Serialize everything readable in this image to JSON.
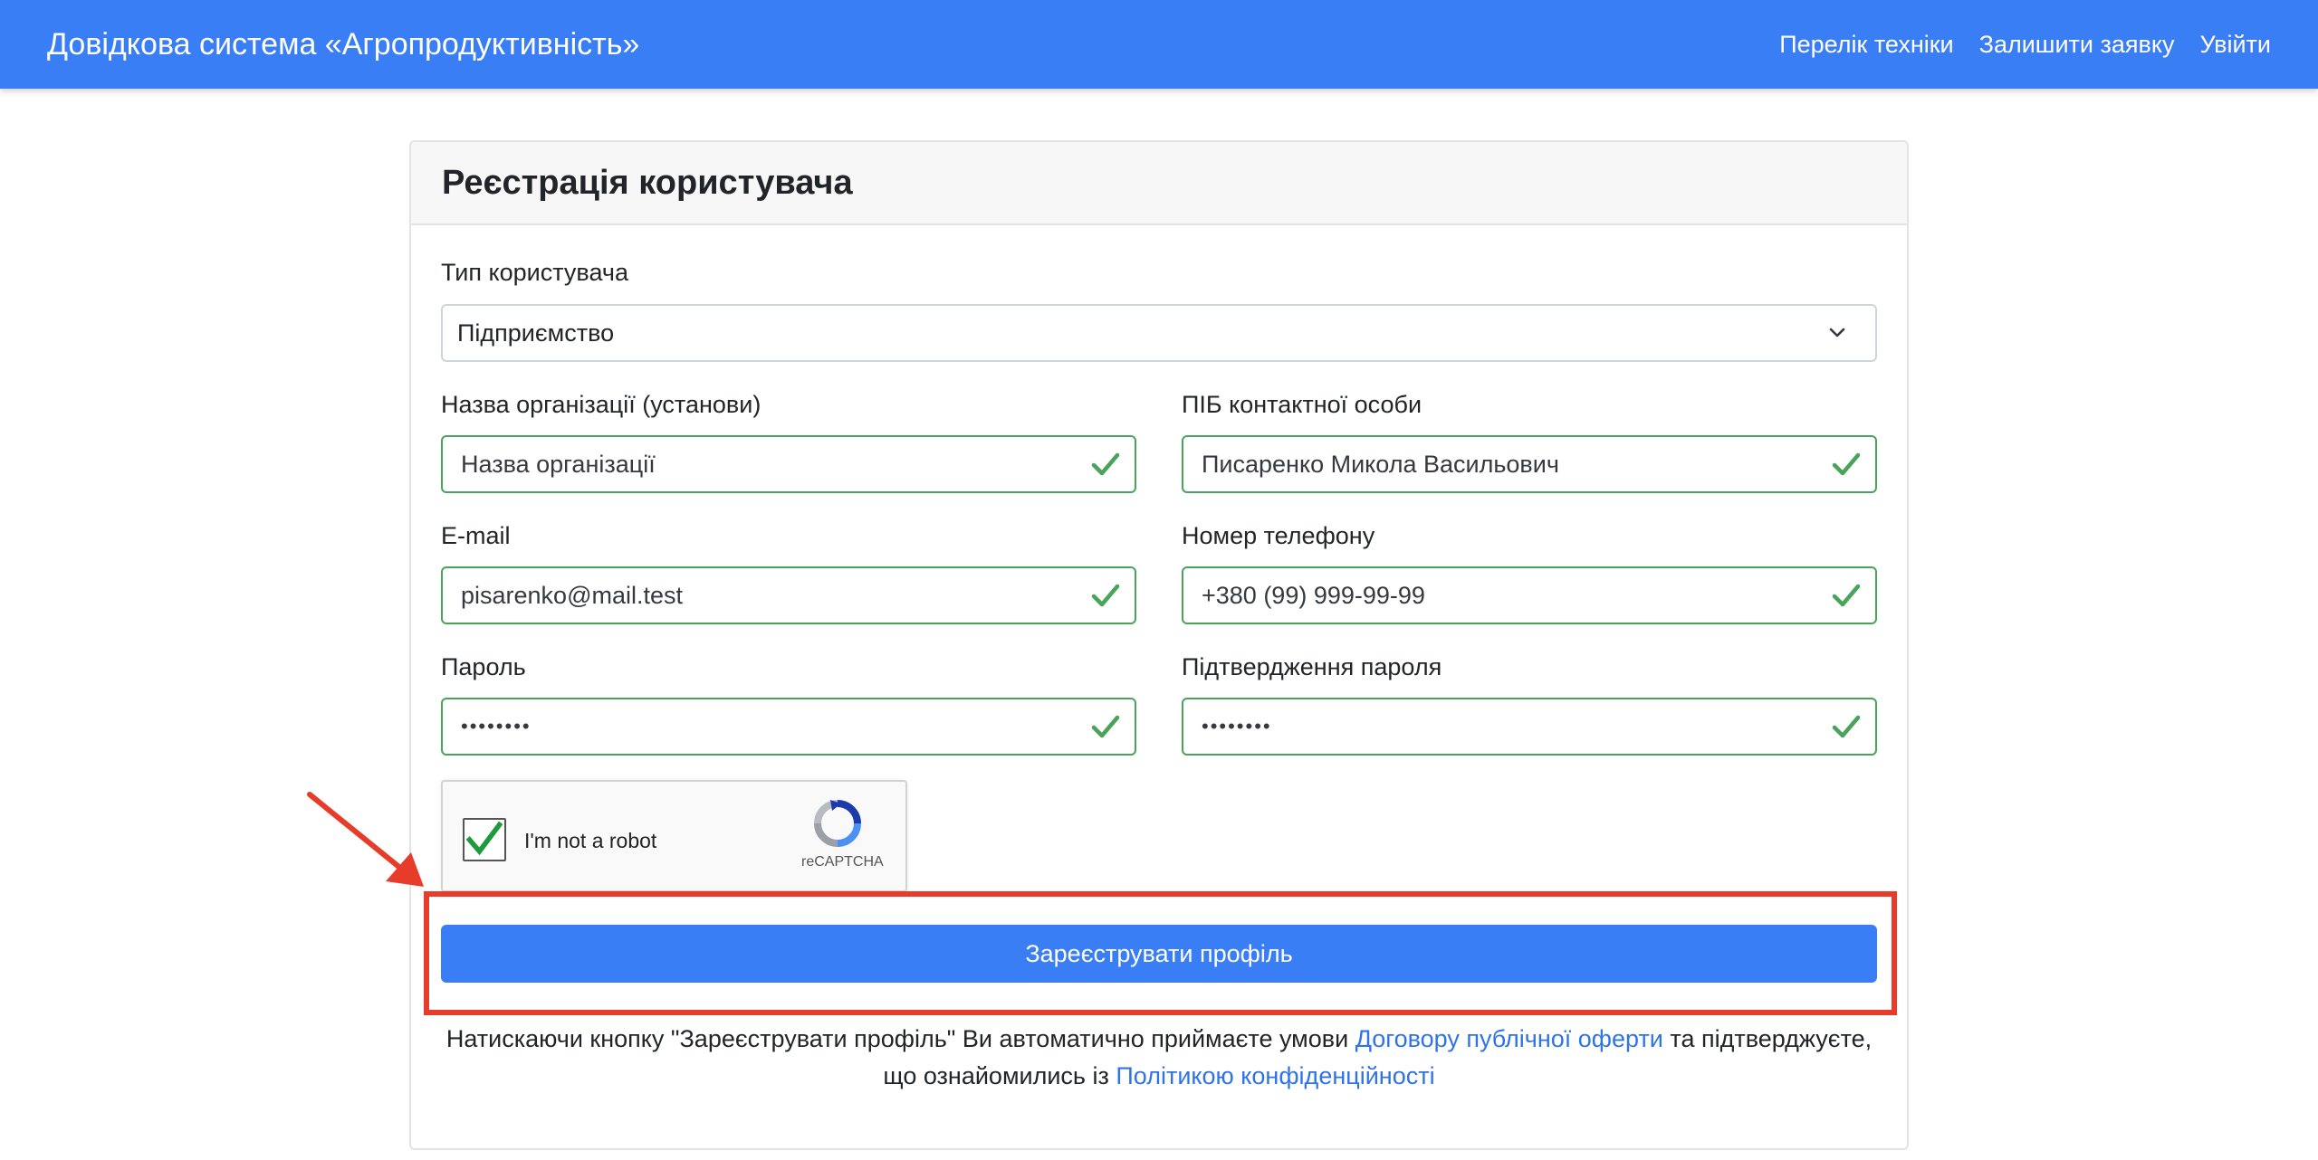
{
  "navbar": {
    "brand": "Довідкова система «Агропродуктивність»",
    "links": [
      "Перелік техніки",
      "Залишити заявку",
      "Увійти"
    ]
  },
  "form": {
    "title": "Реєстрація користувача",
    "user_type": {
      "label": "Тип користувача",
      "value": "Підприємство"
    },
    "org_name": {
      "label": "Назва організації (установи)",
      "value": "Назва організації"
    },
    "contact_name": {
      "label": "ПІБ контактної особи",
      "value": "Писаренко Микола Васильович"
    },
    "email": {
      "label": "E-mail",
      "value": "pisarenko@mail.test"
    },
    "phone": {
      "label": "Номер телефону",
      "value": "+380 (99) 999-99-99"
    },
    "password": {
      "label": "Пароль",
      "value": "••••••••"
    },
    "password_confirm": {
      "label": "Підтвердження пароля",
      "value": "••••••••"
    },
    "recaptcha": {
      "text": "I'm not a robot",
      "brand": "reCAPTCHA"
    },
    "submit_label": "Зареєструвати профіль",
    "notice": {
      "part1": "Натискаючи кнопку \"Зареєструвати профіль\" Ви автоматично приймаєте умови ",
      "link1": "Договору публічної оферти",
      "part2": " та підтверджуєте, що ознайомились із ",
      "link2": "Політикою конфіденційності"
    }
  },
  "colors": {
    "primary": "#3a7ef6",
    "valid": "#4aa35b",
    "annotation": "#e83c2b"
  }
}
